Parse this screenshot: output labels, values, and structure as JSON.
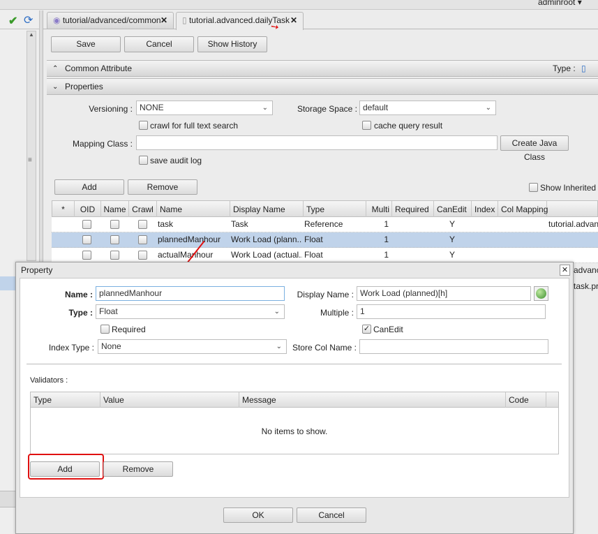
{
  "user": {
    "name": "adminroot"
  },
  "tabs": [
    {
      "label": "tutorial/advanced/common",
      "icon": "speech-bubble-icon"
    },
    {
      "label": "tutorial.advanced.dailyTask",
      "icon": "database-icon",
      "active": true
    }
  ],
  "toolbar": {
    "save": "Save",
    "cancel": "Cancel",
    "history": "Show History"
  },
  "common_attr": {
    "title": "Common Attribute",
    "type_label": "Type :"
  },
  "properties": {
    "title": "Properties",
    "versioning_label": "Versioning :",
    "versioning": "NONE",
    "storage_label": "Storage Space :",
    "storage": "default",
    "crawl": "crawl for full text search",
    "cache": "cache query result",
    "mapping_label": "Mapping Class :",
    "mapping": "",
    "create_java": "Create Java Class",
    "audit": "save audit log",
    "add": "Add",
    "remove": "Remove",
    "show_inherited": "Show Inherited P"
  },
  "grid": {
    "headers": [
      "*",
      "OID",
      "Name",
      "Crawl",
      "Name",
      "Display Name",
      "Type",
      "Multi",
      "Required",
      "CanEdit",
      "Index",
      "Col Mapping"
    ],
    "rows": [
      {
        "name": "task",
        "display": "Task",
        "type": "Reference",
        "multi": "1",
        "canedit": "Y",
        "mapping": "tutorial.advanc"
      },
      {
        "name": "plannedManhour",
        "display": "Work Load (plann...",
        "type": "Float",
        "multi": "1",
        "canedit": "Y",
        "mapping": "",
        "selected": true
      },
      {
        "name": "actualManhour",
        "display": "Work Load (actual...",
        "type": "Float",
        "multi": "1",
        "canedit": "Y",
        "mapping": ""
      }
    ],
    "hidden_rows": [
      "advanc",
      "task.pro"
    ]
  },
  "dialog": {
    "title": "Property",
    "name_label": "Name :",
    "name": "plannedManhour",
    "display_label": "Display Name :",
    "display": "Work Load (planned)[h]",
    "type_label": "Type :",
    "type": "Float",
    "multiple_label": "Multiple :",
    "multiple": "1",
    "required": "Required",
    "canedit": "CanEdit",
    "index_label": "Index Type :",
    "index": "None",
    "storecol_label": "Store Col Name :",
    "storecol": "",
    "validators_label": "Validators :",
    "vheaders": [
      "Type",
      "Value",
      "Message",
      "Code"
    ],
    "empty": "No items to show.",
    "add": "Add",
    "remove": "Remove",
    "ok": "OK",
    "cancel": "Cancel"
  },
  "colors": {
    "selected_row": "#c0d3ea",
    "highlight": "#e01010",
    "accent": "#2b6cc4"
  }
}
